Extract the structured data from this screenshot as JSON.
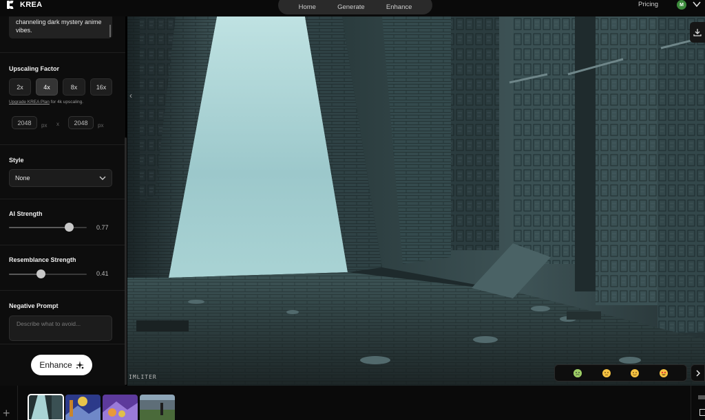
{
  "header": {
    "logo_text": "KREA",
    "nav": [
      "Home",
      "Generate",
      "Enhance"
    ],
    "pricing_label": "Pricing",
    "avatar_initial": "M"
  },
  "panel": {
    "prompt_text": "channeling dark mystery anime vibes.",
    "upscaling": {
      "title": "Upscaling Factor",
      "factors": [
        "2x",
        "4x",
        "8x",
        "16x"
      ],
      "selected": "4x",
      "upgrade_link": "Upgrade KREA Plan",
      "upgrade_suffix": " for 4k upscaling.",
      "width": "2048",
      "height": "2048",
      "unit": "px",
      "x_label": "x"
    },
    "style": {
      "title": "Style",
      "selected": "None"
    },
    "ai_strength": {
      "title": "AI Strength",
      "value": 0.77,
      "display": "0.77"
    },
    "resemblance": {
      "title": "Resemblance Strength",
      "value": 0.41,
      "display": "0.41"
    },
    "negative_prompt": {
      "title": "Negative Prompt",
      "placeholder": "Describe what to avoid..."
    },
    "enhance_label": "Enhance"
  },
  "canvas": {
    "watermark": "IMLITER"
  },
  "feedback": {
    "emojis": [
      "sick-face",
      "neutral-face",
      "smiling-face",
      "heart-eyes-face"
    ]
  },
  "colors": {
    "accent": "#ffffff",
    "panel_bg": "#0d0d0d",
    "avatar_bg": "#3c8a3c"
  }
}
